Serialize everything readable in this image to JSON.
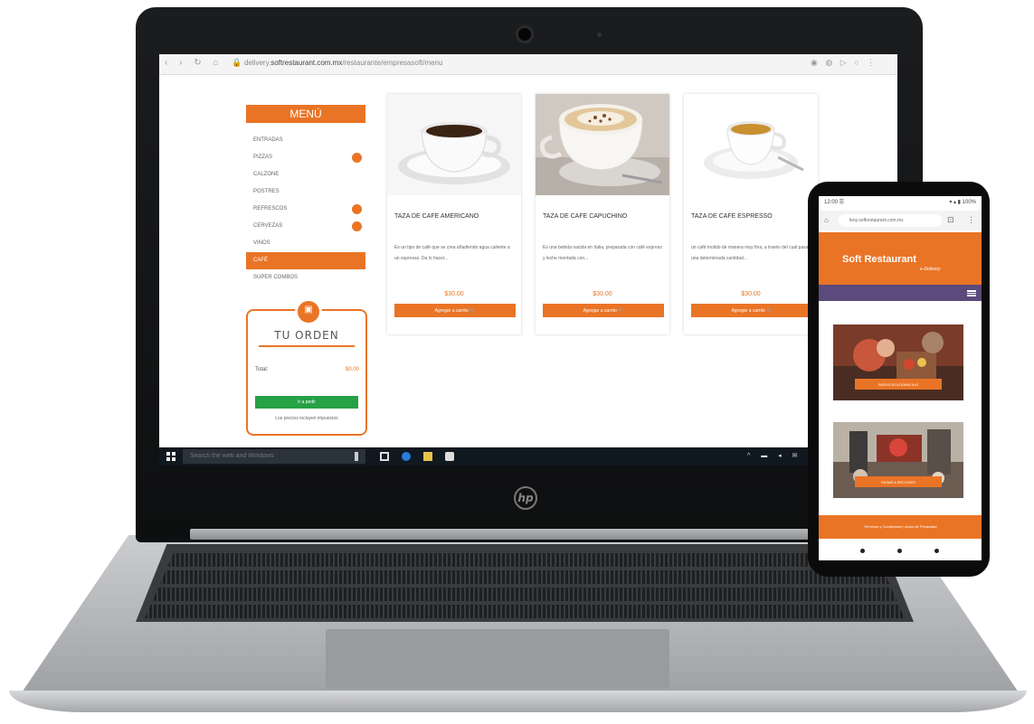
{
  "browser": {
    "url_prefix": "delivery.",
    "url_domain": "softrestaurant.com.mx",
    "url_path": "/restaurante/empresasoft/menu"
  },
  "menu": {
    "title": "MENÚ",
    "items": [
      {
        "label": "ENTRADAS",
        "badge": false,
        "active": false
      },
      {
        "label": "PIZZAS",
        "badge": true,
        "active": false
      },
      {
        "label": "CALZONE",
        "badge": false,
        "active": false
      },
      {
        "label": "POSTRES",
        "badge": false,
        "active": false
      },
      {
        "label": "REFRESCOS",
        "badge": true,
        "active": false
      },
      {
        "label": "CERVEZAS",
        "badge": true,
        "active": false
      },
      {
        "label": "VINOS",
        "badge": false,
        "active": false
      },
      {
        "label": "CAFÉ",
        "badge": false,
        "active": true
      },
      {
        "label": "SUPER COMBOS",
        "badge": false,
        "active": false
      }
    ]
  },
  "order": {
    "title": "TU ORDEN",
    "total_label": "Total:",
    "total_value": "$0.00",
    "checkout_label": "Ir a pedir",
    "note": "Los precios incluyen impuestos"
  },
  "products": [
    {
      "title": "TAZA DE CAFE AMERICANO",
      "desc": "Es un tipo de café que se crea añadiendo agua caliente a un espresso. Da lo hacer...",
      "price": "$30.00",
      "button": "Agregar a carrito"
    },
    {
      "title": "TAZA DE CAFE CAPUCHINO",
      "desc": "Es una bebida nacida en Italia, preparada con café expreso y leche montada con...",
      "price": "$30.00",
      "button": "Agregar a carrito"
    },
    {
      "title": "TAZA DE CAFE ESPRESSO",
      "desc": "un café molido de manera muy fina, a través del cual pasa una determinada cantidad...",
      "price": "$30.00",
      "button": "Agregar a carrito"
    }
  ],
  "taskbar": {
    "search_placeholder": "Search the web and Windows"
  },
  "phone": {
    "status_left": "12:00 ☰",
    "status_right": "▾ ▴ ▮ 100%",
    "url": "leny.softrestaurant.com.mx",
    "logo": "Soft Restaurant",
    "logo_sub": "e-Delivery",
    "tiles": [
      {
        "button": "SERVICIO A DOMICILIO"
      },
      {
        "button": "PASAR A RECOGER"
      }
    ],
    "footer": "Términos y Condiciones | Aviso de Privacidad"
  },
  "colors": {
    "accent": "#ea7425",
    "checkout": "#27a145",
    "phone_nav": "#5b4a7b",
    "taskbar": "#101820"
  }
}
